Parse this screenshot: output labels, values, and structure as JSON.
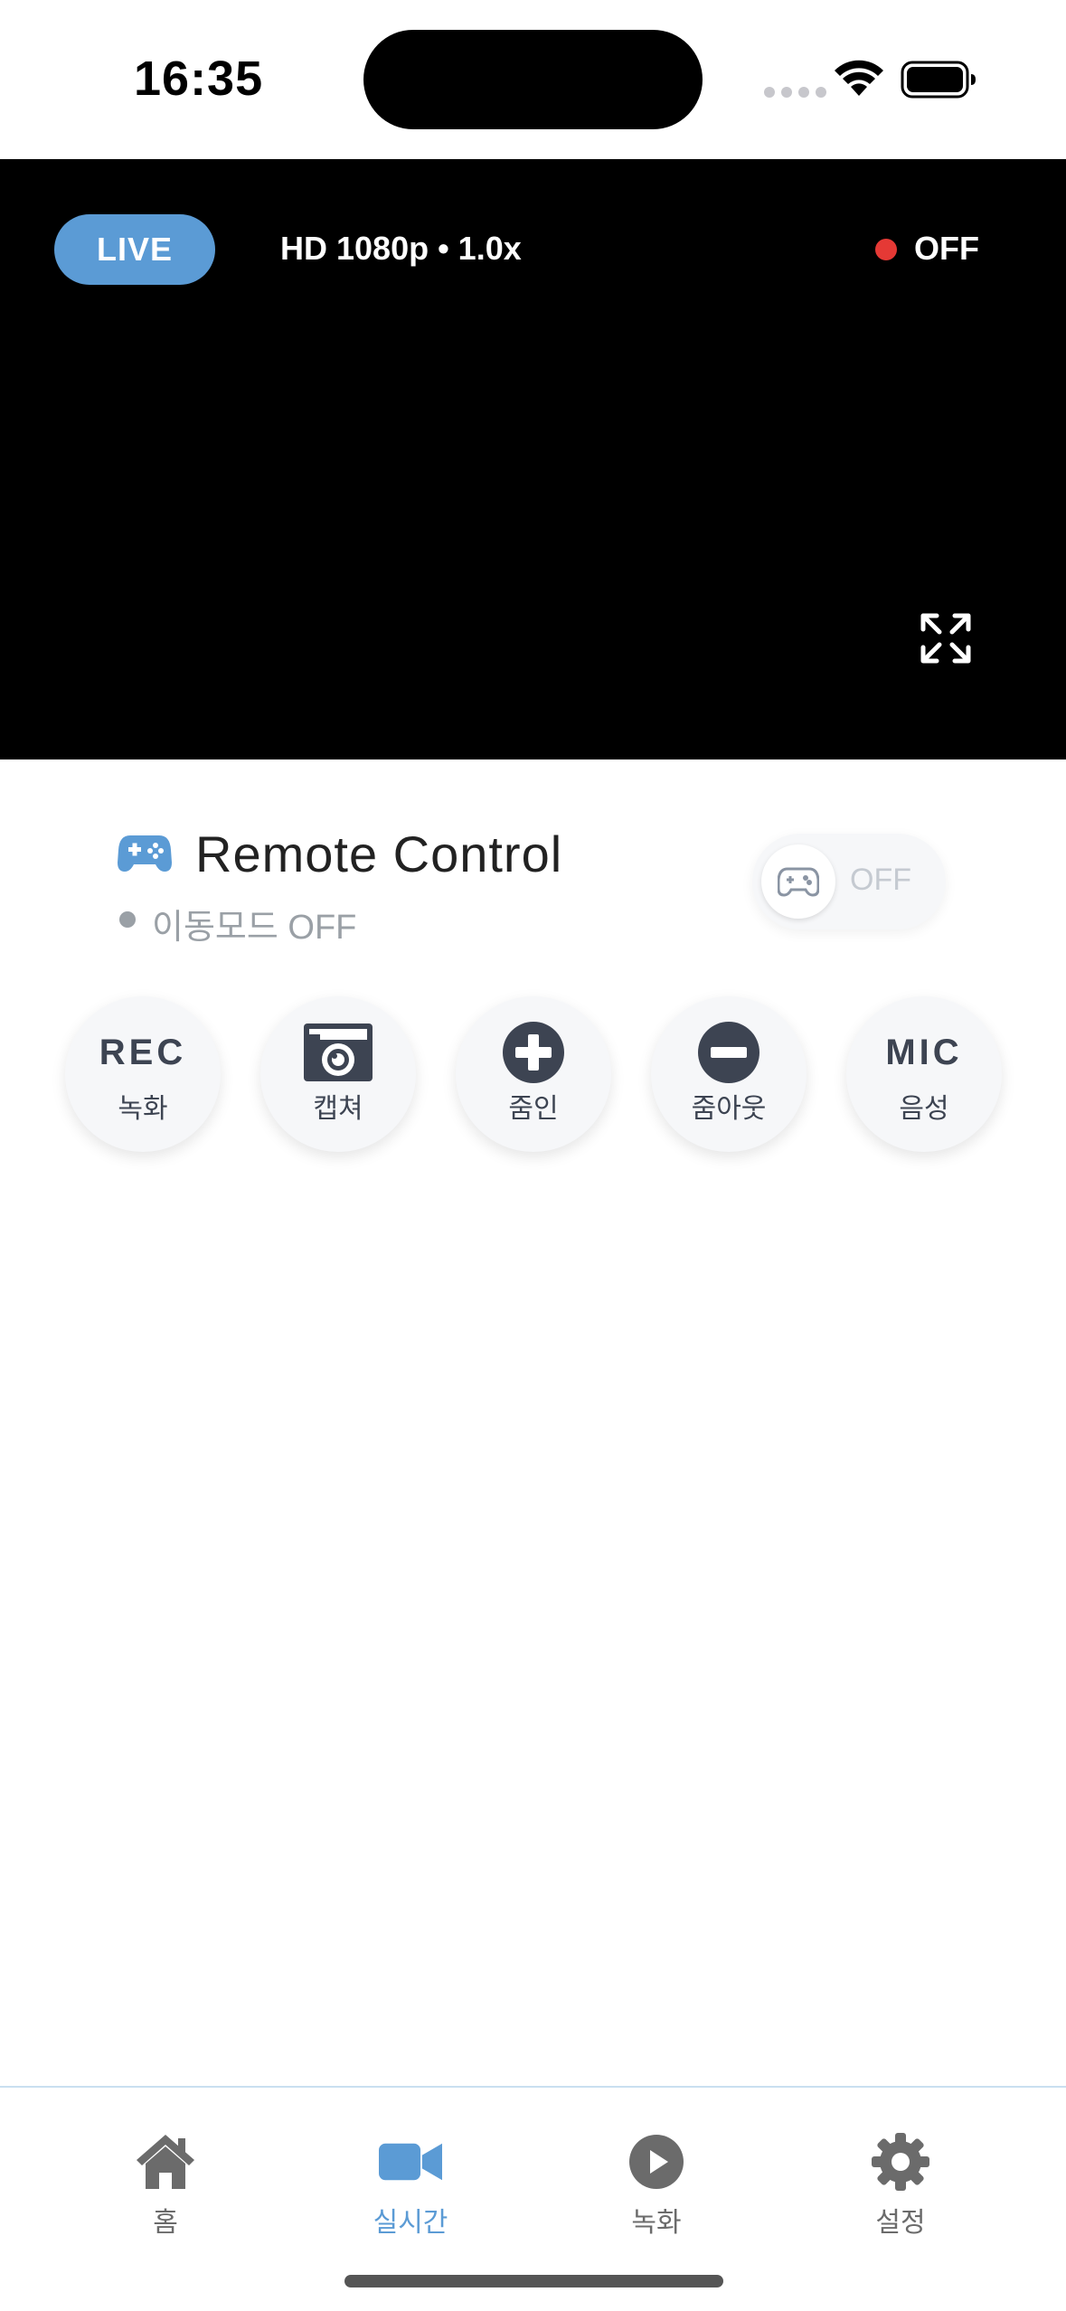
{
  "status_bar": {
    "time": "16:35"
  },
  "video": {
    "live_label": "LIVE",
    "quality": "HD 1080p • 1.0x",
    "record_status": "OFF"
  },
  "remote_control": {
    "title": "Remote Control",
    "mode_text": "이동모드 OFF",
    "toggle_label": "OFF"
  },
  "controls": [
    {
      "top": "REC",
      "label": "녹화"
    },
    {
      "icon": "camera-icon",
      "label": "캡쳐"
    },
    {
      "icon": "plus-circle-icon",
      "label": "줌인"
    },
    {
      "icon": "minus-circle-icon",
      "label": "줌아웃"
    },
    {
      "top": "MIC",
      "label": "음성"
    }
  ],
  "tabbar": {
    "items": [
      {
        "label": "홈",
        "icon": "home-icon"
      },
      {
        "label": "실시간",
        "icon": "video-camera-icon",
        "active": true
      },
      {
        "label": "녹화",
        "icon": "play-circle-icon"
      },
      {
        "label": "설정",
        "icon": "gear-icon"
      }
    ]
  },
  "colors": {
    "accent": "#5b9bd5",
    "record_dot": "#e53935",
    "control_icon": "#3d4452"
  }
}
